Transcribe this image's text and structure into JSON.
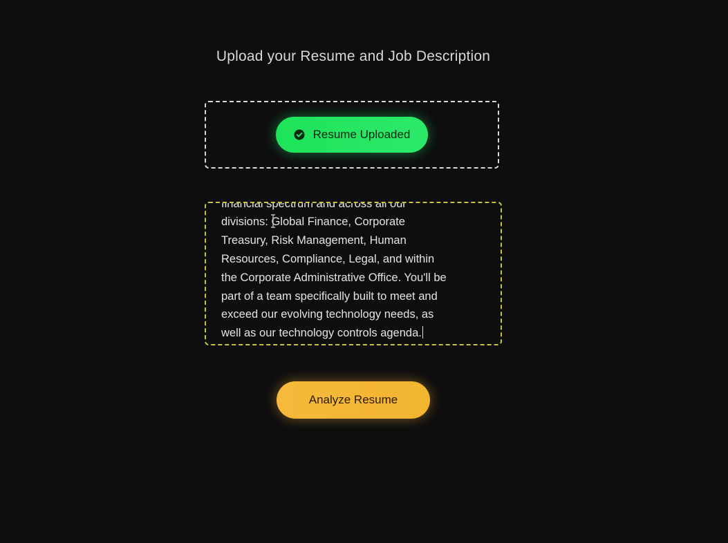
{
  "header": {
    "title": "Upload your Resume and Job Description"
  },
  "upload": {
    "status_label": "Resume Uploaded",
    "status_icon": "check-circle-icon",
    "accent_color": "#22e35e"
  },
  "job_description": {
    "value": "financial spectrum and across all our\ndivisions: Global Finance, Corporate\nTreasury, Risk Management, Human\nResources, Compliance, Legal, and within\nthe Corporate Administrative Office. You'll be\npart of a team specifically built to meet and\nexceed our evolving technology needs, as\nwell as our technology controls agenda.",
    "border_color": "#c9c43a"
  },
  "actions": {
    "analyze_label": "Analyze Resume",
    "analyze_color": "#f4b735"
  }
}
